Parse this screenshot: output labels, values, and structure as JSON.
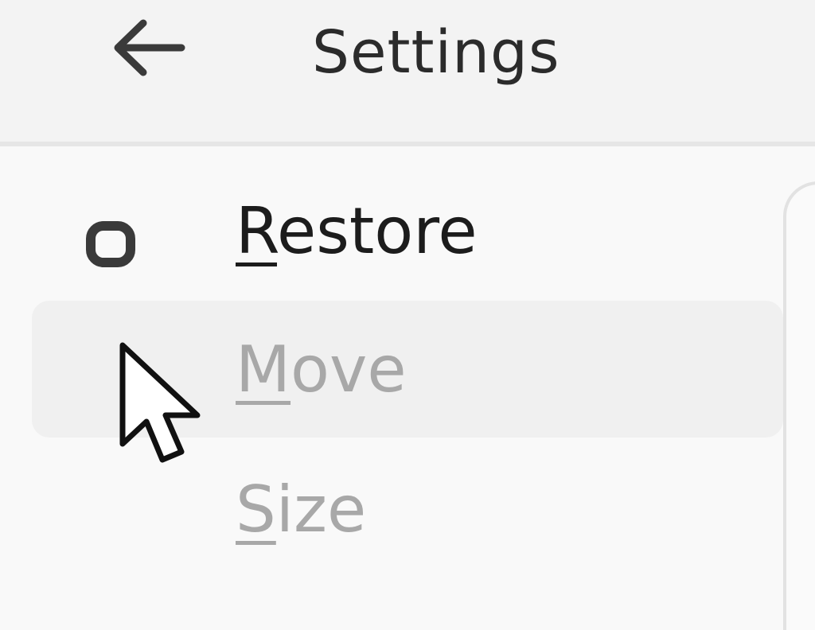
{
  "window": {
    "title": "Settings",
    "back_icon": "back-arrow-icon"
  },
  "menu": {
    "items": [
      {
        "first": "R",
        "rest": "estore",
        "enabled": true,
        "icon": "restore-icon",
        "hovered": false
      },
      {
        "first": "M",
        "rest": "ove",
        "enabled": false,
        "icon": "",
        "hovered": true
      },
      {
        "first": "S",
        "rest": "ize",
        "enabled": false,
        "icon": "",
        "hovered": false
      }
    ]
  },
  "cursor": {
    "icon": "mouse-pointer-icon"
  },
  "colors": {
    "enabled_text": "#1c1c1c",
    "disabled_text": "#a8a8a8",
    "hover_background": "#f0f0f0",
    "titlebar_background": "#f3f3f3"
  }
}
